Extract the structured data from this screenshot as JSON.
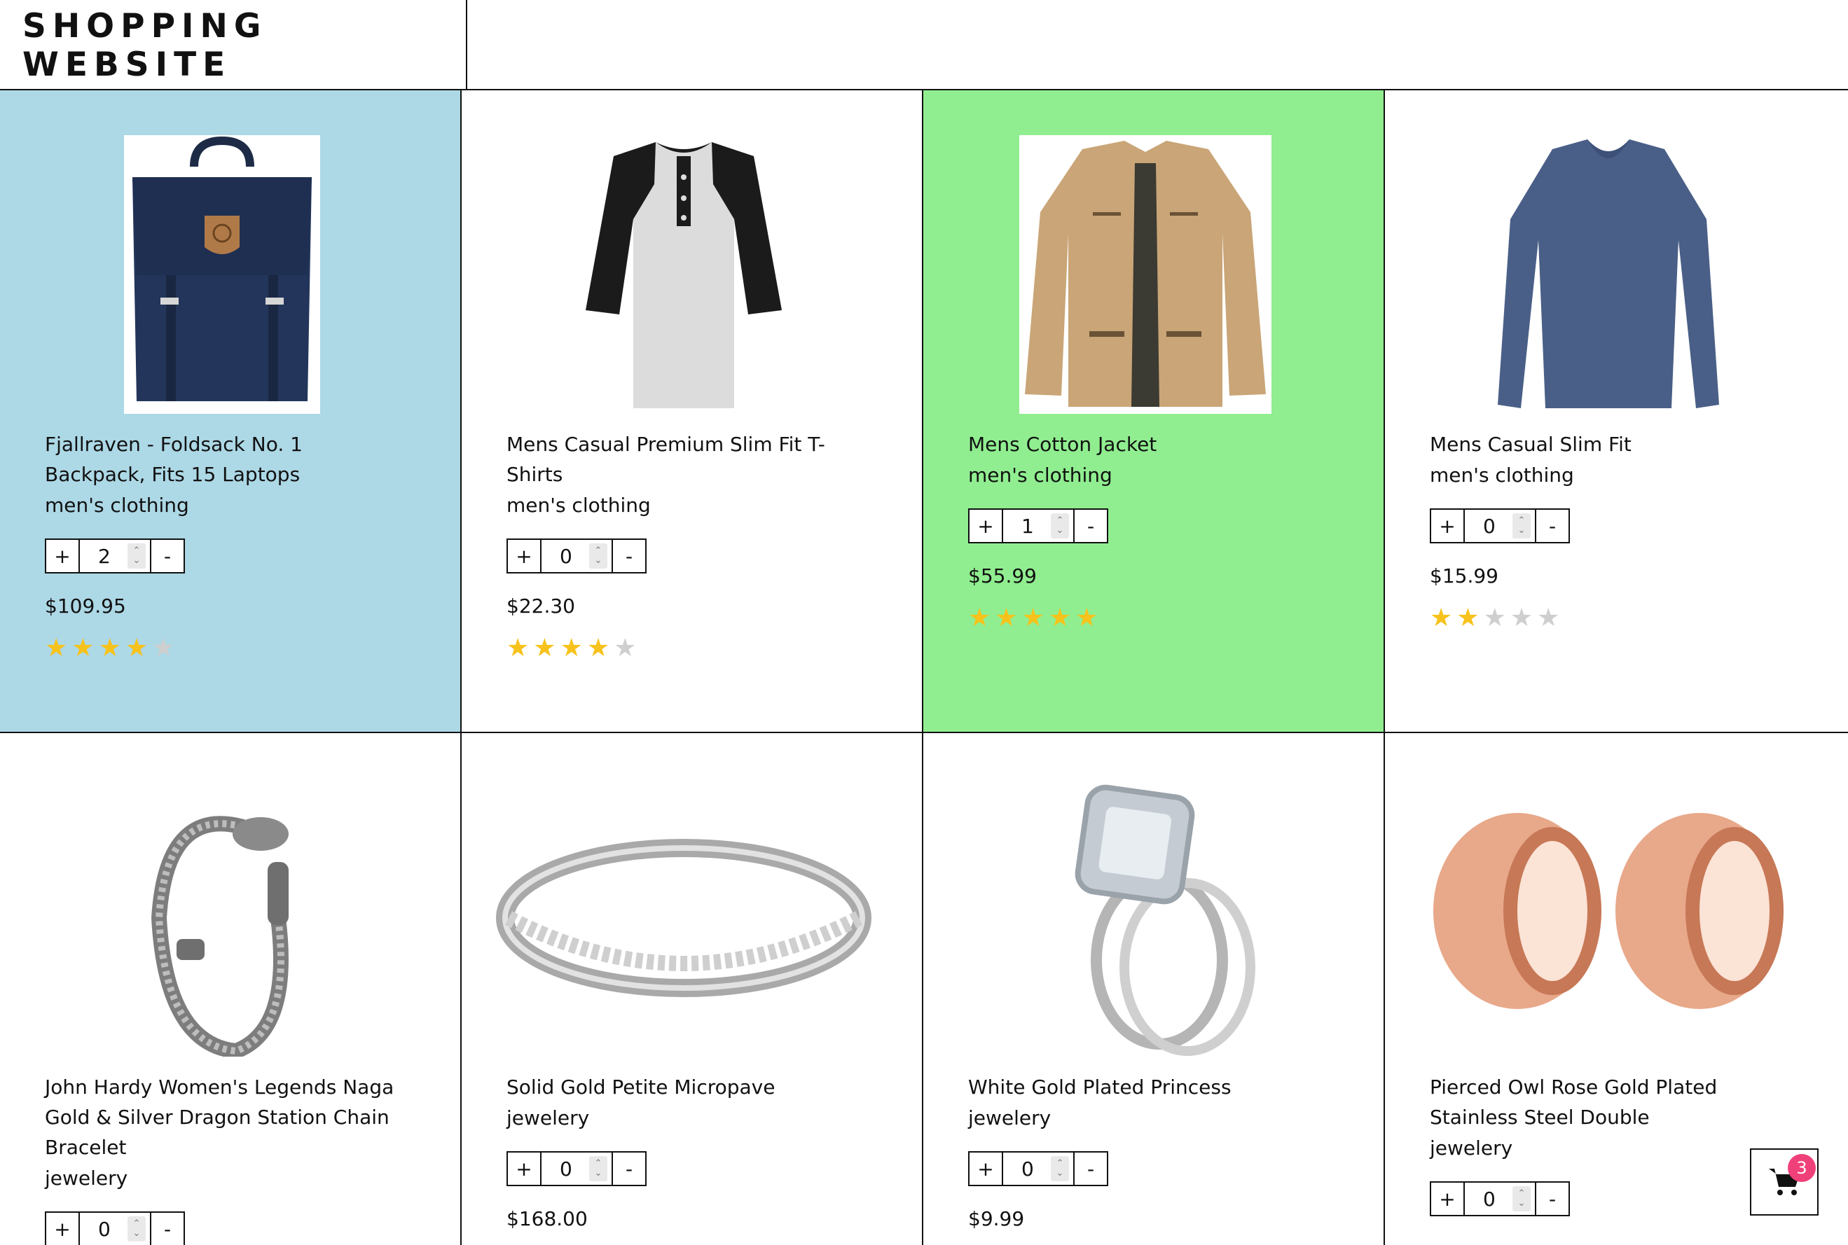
{
  "header": {
    "title": "SHOPPING WEBSITE"
  },
  "colors": {
    "highlight_blue": "#add8e6",
    "highlight_green": "#90ee90",
    "star": "#f7c21b",
    "badge": "#f0407a"
  },
  "products": [
    {
      "title": "Fjallraven - Foldsack No. 1 Backpack, Fits 15 Laptops",
      "category": "men's clothing",
      "quantity": "2",
      "price": "$109.95",
      "rating": 4,
      "image": "backpack",
      "highlight": "blue"
    },
    {
      "title": "Mens Casual Premium Slim Fit T-Shirts",
      "category": "men's clothing",
      "quantity": "0",
      "price": "$22.30",
      "rating": 4,
      "image": "tshirt",
      "highlight": "none"
    },
    {
      "title": "Mens Cotton Jacket",
      "category": "men's clothing",
      "quantity": "1",
      "price": "$55.99",
      "rating": 5,
      "image": "jacket",
      "highlight": "green"
    },
    {
      "title": "Mens Casual Slim Fit",
      "category": "men's clothing",
      "quantity": "0",
      "price": "$15.99",
      "rating": 2,
      "image": "longsleeve",
      "highlight": "none"
    },
    {
      "title": "John Hardy Women's Legends Naga Gold & Silver Dragon Station Chain Bracelet",
      "category": "jewelery",
      "quantity": "0",
      "price": "",
      "rating": 0,
      "image": "bracelet",
      "highlight": "none"
    },
    {
      "title": "Solid Gold Petite Micropave",
      "category": "jewelery",
      "quantity": "0",
      "price": "$168.00",
      "rating": 0,
      "image": "ring",
      "highlight": "none"
    },
    {
      "title": "White Gold Plated Princess",
      "category": "jewelery",
      "quantity": "0",
      "price": "$9.99",
      "rating": 0,
      "image": "diamond-ring",
      "highlight": "none"
    },
    {
      "title": "Pierced Owl Rose Gold Plated Stainless Steel Double",
      "category": "jewelery",
      "quantity": "0",
      "price": "",
      "rating": 0,
      "image": "tunnel-plugs",
      "highlight": "none"
    }
  ],
  "controls": {
    "plus": "+",
    "minus": "-"
  },
  "cart": {
    "count": "3",
    "icon": "cart-icon"
  }
}
